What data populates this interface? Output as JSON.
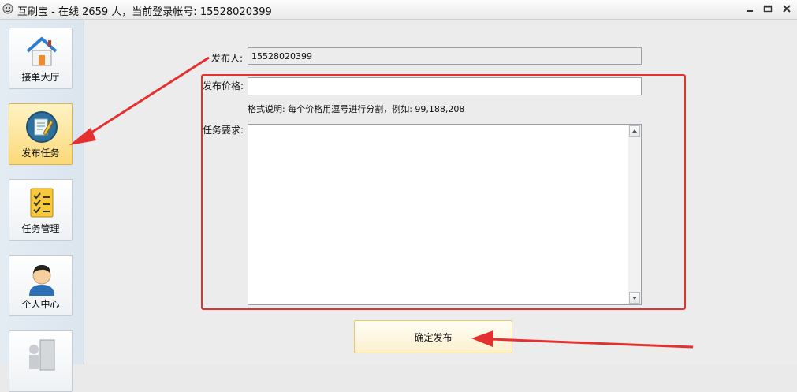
{
  "window": {
    "title": "互刷宝 - 在线 2659 人，当前登录帐号: 15528020399",
    "app_icon": "sloth-face-icon",
    "controls": [
      "minimize-icon",
      "restore-icon",
      "close-icon"
    ]
  },
  "sidebar": {
    "items": [
      {
        "label": "接单大厅",
        "icon": "house-icon",
        "active": false
      },
      {
        "label": "发布任务",
        "icon": "pen-paper-icon",
        "active": true
      },
      {
        "label": "任务管理",
        "icon": "checklist-icon",
        "active": false
      },
      {
        "label": "个人中心",
        "icon": "user-avatar-icon",
        "active": false
      },
      {
        "label": "",
        "icon": "door-exit-icon",
        "active": false
      }
    ]
  },
  "form": {
    "publisher_label": "发布人:",
    "publisher_value": "15528020399",
    "price_label": "发布价格:",
    "price_value": "",
    "format_hint": "格式说明: 每个价格用逗号进行分割，例如: 99,188,208",
    "requirement_label": "任务要求:",
    "requirement_value": "",
    "submit_label": "确定发布"
  },
  "annotations": {
    "highlight_color": "#e53030"
  }
}
